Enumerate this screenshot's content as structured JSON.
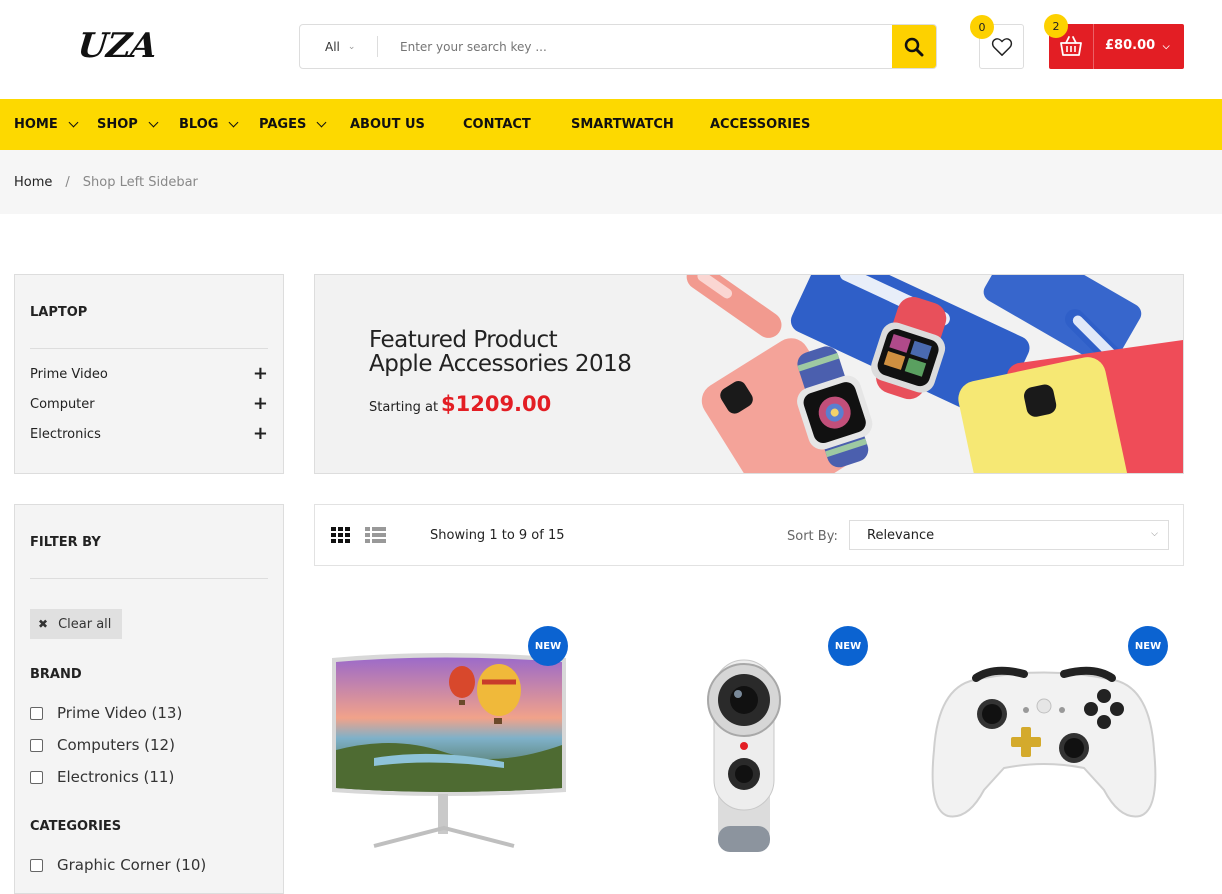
{
  "header": {
    "logo": "UZA",
    "search": {
      "category": "All",
      "placeholder": "Enter your search key ..."
    },
    "wishlist_count": "0",
    "cart": {
      "count": "2",
      "amount": "£80.00"
    }
  },
  "nav": {
    "items": [
      {
        "label": "HOME"
      },
      {
        "label": "SHOP"
      },
      {
        "label": "BLOG"
      },
      {
        "label": "PAGES"
      },
      {
        "label": "ABOUT US"
      },
      {
        "label": "CONTACT"
      },
      {
        "label": "SMARTWATCH"
      },
      {
        "label": "ACCESSORIES"
      }
    ]
  },
  "breadcrumb": {
    "home": "Home",
    "separator": "/",
    "current": "Shop Left Sidebar"
  },
  "sidebar": {
    "laptop": {
      "title": "LAPTOP",
      "items": [
        "Prime Video",
        "Computer",
        "Electronics"
      ]
    },
    "filter": {
      "title": "FILTER BY",
      "clear_all": "Clear all",
      "brand_title": "BRAND",
      "brands": [
        "Prime Video (13)",
        "Computers (12)",
        "Electronics (11)"
      ],
      "categories_title": "CATEGORIES",
      "categories": [
        "Graphic Corner (10)"
      ]
    }
  },
  "banner": {
    "line1": "Featured Product",
    "line2": "Apple Accessories 2018",
    "starting_at": "Starting at",
    "price": "$1209.00"
  },
  "toolbar": {
    "showing": "Showing 1 to 9 of 15",
    "sort_label": "Sort By:",
    "sort_value": "Relevance"
  },
  "products": [
    {
      "badge": "NEW",
      "image": "curved-monitor"
    },
    {
      "badge": "NEW",
      "image": "360-camera"
    },
    {
      "badge": "NEW",
      "image": "game-controller"
    }
  ],
  "colors": {
    "nav_yellow": "#fdd900",
    "accent_red": "#e31e24",
    "badge_blue": "#0b63d1"
  }
}
